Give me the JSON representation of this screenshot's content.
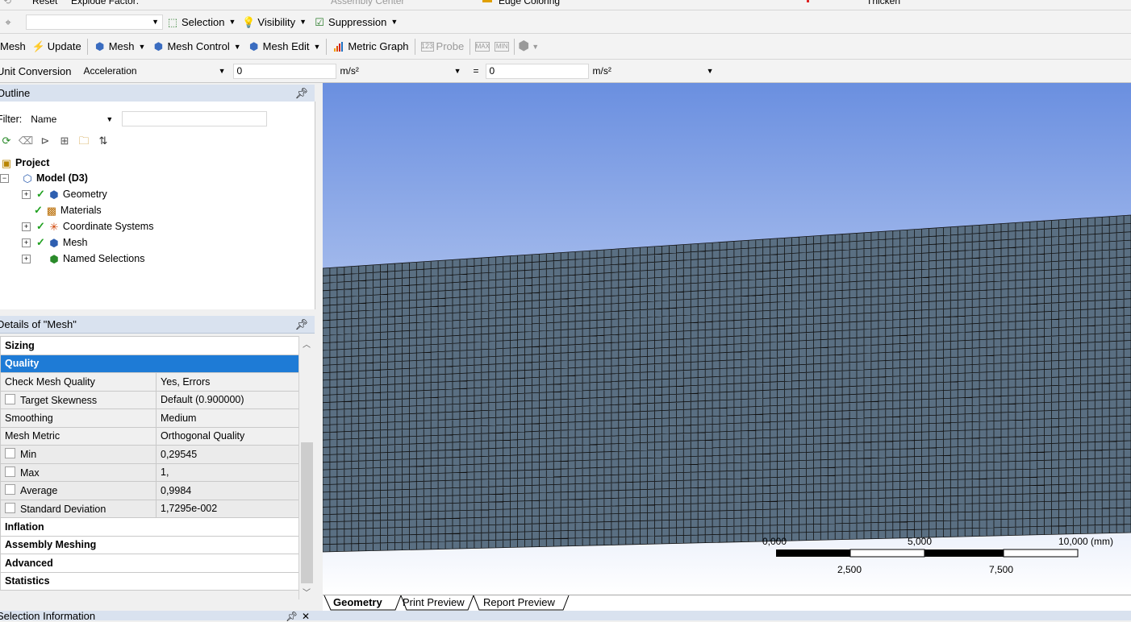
{
  "toolbar_top": {
    "reset": "Reset",
    "explode_factor": "Explode Factor:",
    "assembly_center": "Assembly Center",
    "edge_coloring": "Edge Coloring",
    "thicken": "Thicken"
  },
  "toolbar_select": {
    "selection": "Selection",
    "visibility": "Visibility",
    "suppression": "Suppression"
  },
  "toolbar_mesh": {
    "mesh_label": "Mesh",
    "update": "Update",
    "mesh_menu": "Mesh",
    "mesh_control": "Mesh Control",
    "mesh_edit": "Mesh Edit",
    "metric_graph": "Metric Graph",
    "probe": "Probe"
  },
  "unit_conversion": {
    "label": "Unit Conversion",
    "quantity": "Acceleration",
    "value_left": "0",
    "unit_left": "m/s²",
    "equals": "=",
    "value_right": "0",
    "unit_right": "m/s²"
  },
  "outline": {
    "title": "Outline",
    "filter_label": "Filter:",
    "filter_value": "Name",
    "filter_text": "",
    "tree": {
      "project": "Project",
      "model": "Model (D3)",
      "geometry": "Geometry",
      "materials": "Materials",
      "coordinate_systems": "Coordinate Systems",
      "mesh": "Mesh",
      "named_selections": "Named Selections"
    }
  },
  "details": {
    "title": "Details of \"Mesh\"",
    "rows": [
      {
        "label": "Sizing",
        "value": ""
      },
      {
        "label": "Quality",
        "value": ""
      },
      {
        "label": "Check Mesh Quality",
        "value": "Yes, Errors"
      },
      {
        "label": "Target Skewness",
        "value": "Default (0.900000)"
      },
      {
        "label": "Smoothing",
        "value": "Medium"
      },
      {
        "label": "Mesh Metric",
        "value": "Orthogonal Quality"
      },
      {
        "label": "Min",
        "value": "0,29545"
      },
      {
        "label": "Max",
        "value": "1,"
      },
      {
        "label": "Average",
        "value": "0,9984"
      },
      {
        "label": "Standard Deviation",
        "value": "1,7295e-002"
      },
      {
        "label": "Inflation",
        "value": ""
      },
      {
        "label": "Assembly Meshing",
        "value": ""
      },
      {
        "label": "Advanced",
        "value": ""
      },
      {
        "label": "Statistics",
        "value": ""
      }
    ]
  },
  "scale_bar": {
    "top_labels": [
      "0,000",
      "5,000",
      "10,000 (mm)"
    ],
    "bottom_labels": [
      "2,500",
      "7,500"
    ]
  },
  "view_tabs": [
    "Geometry",
    "Print Preview",
    "Report Preview"
  ],
  "selection_information": "Selection Information",
  "colors": {
    "sky_top": "#6a8fe0",
    "sky_bottom": "#ffffff",
    "mesh_fill": "#5a6f82",
    "mesh_lines": "#111111",
    "selected_row": "#1e7bd6",
    "panel_header": "#d9e2ef"
  }
}
